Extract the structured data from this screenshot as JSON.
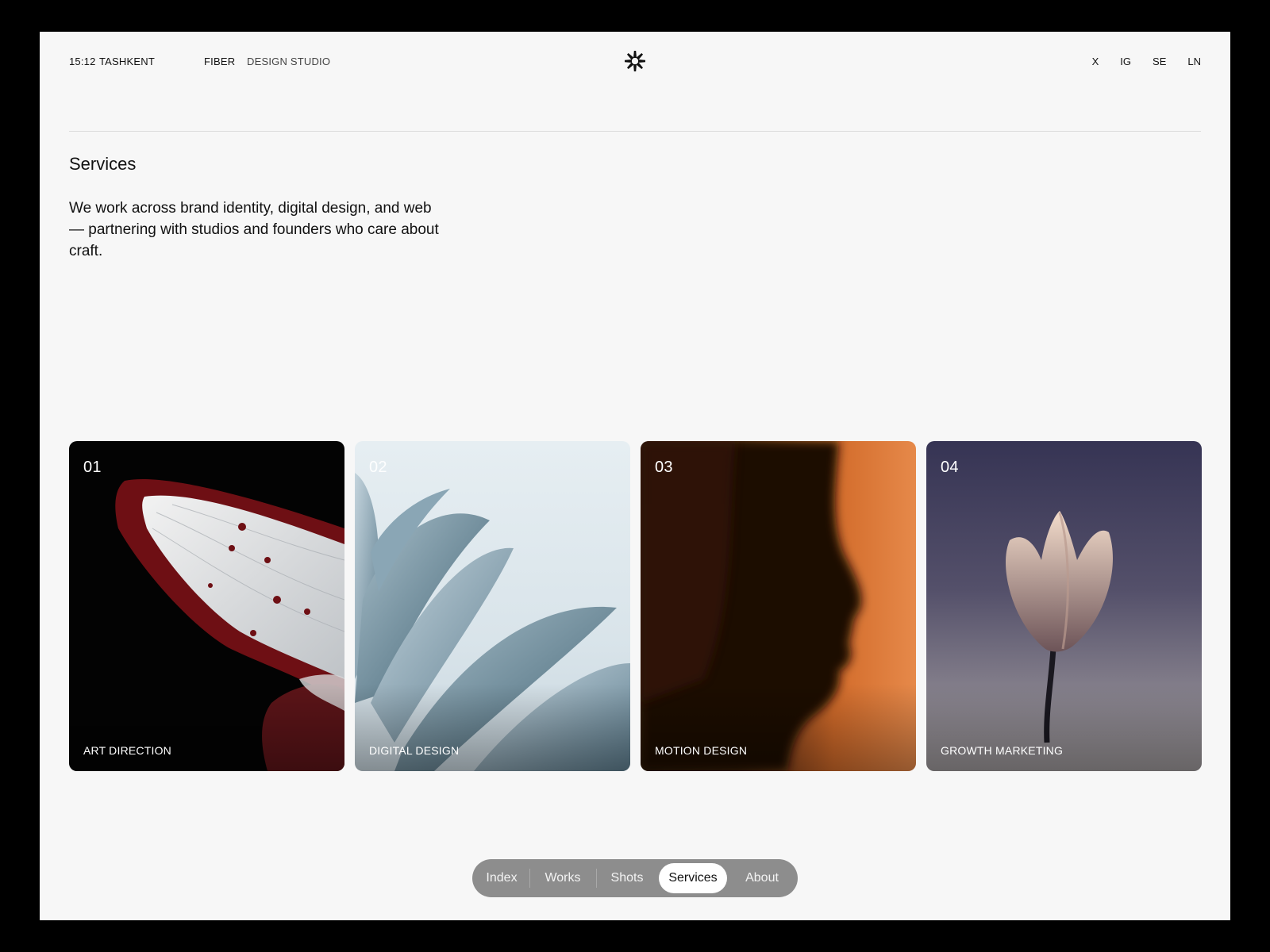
{
  "header": {
    "time": "15:12",
    "city": "TASHKENT",
    "brand": "FIBER",
    "tagline": "DESIGN STUDIO",
    "logo_icon": "asterisk-logo-icon",
    "socials": [
      "X",
      "IG",
      "SE",
      "LN"
    ]
  },
  "services": {
    "title": "Services",
    "intro": "We work across brand identity, digital design, and web — partnering with studios and founders who care about craft.",
    "cards": [
      {
        "number": "01",
        "label": "ART DIRECTION",
        "image": "butterfly-wing"
      },
      {
        "number": "02",
        "label": "DIGITAL DESIGN",
        "image": "pale-blue-petals"
      },
      {
        "number": "03",
        "label": "MOTION DESIGN",
        "image": "face-profile-orange"
      },
      {
        "number": "04",
        "label": "GROWTH MARKETING",
        "image": "tulip"
      }
    ]
  },
  "nav": {
    "items": [
      "Index",
      "Works",
      "Shots",
      "Services",
      "About"
    ],
    "active": "Services"
  },
  "colors": {
    "page_bg": "#f7f7f7",
    "nav_bg": "#8d8d8d",
    "nav_active_bg": "#ffffff",
    "text": "#111111"
  }
}
